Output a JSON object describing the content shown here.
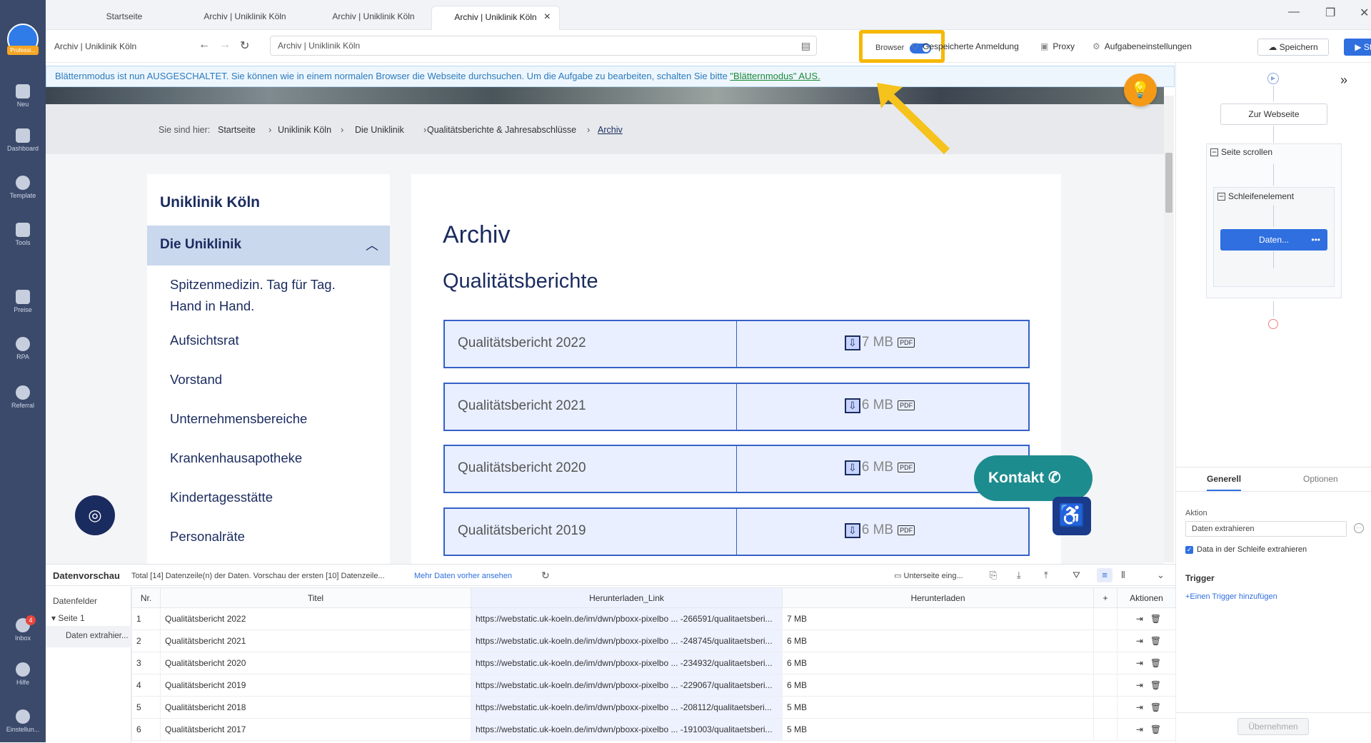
{
  "sidebar": {
    "badge": "Professi...",
    "items": [
      {
        "label": "Neu",
        "icon": "plus-icon"
      },
      {
        "label": "Dashboard",
        "icon": "bookmark-icon"
      },
      {
        "label": "Template",
        "icon": "template-icon"
      },
      {
        "label": "Tools",
        "icon": "toolbox-icon"
      },
      {
        "label": "Preise",
        "icon": "crown-icon"
      },
      {
        "label": "RPA",
        "icon": "robot-icon"
      },
      {
        "label": "Referral",
        "icon": "dollar-icon"
      },
      {
        "label": "Inbox",
        "icon": "bell-icon",
        "badge": "4"
      },
      {
        "label": "Hilfe",
        "icon": "help-icon"
      },
      {
        "label": "Einstellun...",
        "icon": "gear-icon"
      }
    ]
  },
  "tabs": [
    "Startseite",
    "Archiv | Uniklinik Köln",
    "Archiv | Uniklinik Köln",
    "Archiv | Uniklinik Köln"
  ],
  "toolbar": {
    "page_title": "Archiv | Uniklinik Köln",
    "url": "Archiv | Uniklinik Köln",
    "browser_label": "Browser",
    "saved_login": "Gespeicherte Anmeldung",
    "proxy": "Proxy",
    "task_settings": "Aufgabeneinstellungen",
    "save": "Speichern",
    "start": "Starten"
  },
  "banner": {
    "text": "Blätternmodus ist nun AUSGESCHALTET. Sie können wie in einem normalen Browser die Webseite durchsuchen. Um die Aufgabe zu bearbeiten, schalten Sie bitte ",
    "link": "\"Blätternmodus\" AUS."
  },
  "webpage": {
    "breadcrumb_prefix": "Sie sind hier:",
    "breadcrumbs": [
      "Startseite",
      "Uniklinik Köln",
      "Die Uniklinik",
      "Qualitätsberichte & Jahresabschlüsse",
      "Archiv"
    ],
    "nav_heading": "Uniklinik Köln",
    "nav_selected": "Die Uniklinik",
    "nav_items": [
      "Spitzenmedizin. Tag für Tag. Hand in Hand.",
      "Aufsichtsrat",
      "Vorstand",
      "Unternehmensbereiche",
      "Krankenhausapotheke",
      "Kindertagesstätte",
      "Personalräte"
    ],
    "title": "Archiv",
    "subtitle": "Qualitätsberichte",
    "reports": [
      {
        "title": "Qualitätsbericht 2022",
        "size": "7 MB"
      },
      {
        "title": "Qualitätsbericht 2021",
        "size": "6 MB"
      },
      {
        "title": "Qualitätsbericht 2020",
        "size": "6 MB"
      },
      {
        "title": "Qualitätsbericht 2019",
        "size": "6 MB"
      }
    ],
    "pdf_label": "PDF",
    "contact": "Kontakt"
  },
  "workflow": {
    "node_goto": "Zur Webseite",
    "node_scroll": "Seite scrollen",
    "node_loop": "Schleifenelement",
    "node_extract": "Daten...",
    "tab_general": "Generell",
    "tab_options": "Optionen",
    "action_label": "Aktion",
    "action_value": "Daten extrahieren",
    "checkbox_label": "Data in der Schleife extrahieren",
    "trigger_label": "Trigger",
    "add_trigger": "+Einen Trigger hinzufügen",
    "apply": "Übernehmen"
  },
  "preview": {
    "title": "Datenvorschau",
    "summary": "Total [14] Datenzeile(n) der Daten. Vorschau der ersten [10] Datenzeile...",
    "more": "Mehr Daten vorher ansehen",
    "subpage": "Unterseite eing...",
    "fields_label": "Datenfelder",
    "page_label": "Seite 1",
    "extract_label": "Daten extrahier...",
    "columns": [
      "Nr.",
      "Titel",
      "Herunterladen_Link",
      "Herunterladen",
      "+",
      "Aktionen"
    ],
    "rows": [
      [
        "1",
        "Qualitätsbericht 2022",
        "https://webstatic.uk-koeln.de/im/dwn/pboxx-pixelbo ... -266591/qualitaetsberi...",
        "7 MB"
      ],
      [
        "2",
        "Qualitätsbericht 2021",
        "https://webstatic.uk-koeln.de/im/dwn/pboxx-pixelbo ... -248745/qualitaetsberi...",
        "6 MB"
      ],
      [
        "3",
        "Qualitätsbericht 2020",
        "https://webstatic.uk-koeln.de/im/dwn/pboxx-pixelbo ... -234932/qualitaetsberi...",
        "6 MB"
      ],
      [
        "4",
        "Qualitätsbericht 2019",
        "https://webstatic.uk-koeln.de/im/dwn/pboxx-pixelbo ... -229067/qualitaetsberi...",
        "6 MB"
      ],
      [
        "5",
        "Qualitätsbericht 2018",
        "https://webstatic.uk-koeln.de/im/dwn/pboxx-pixelbo ... -208112/qualitaetsberi...",
        "5 MB"
      ],
      [
        "6",
        "Qualitätsbericht 2017",
        "https://webstatic.uk-koeln.de/im/dwn/pboxx-pixelbo ... -191003/qualitaetsberi...",
        "5 MB"
      ]
    ]
  }
}
